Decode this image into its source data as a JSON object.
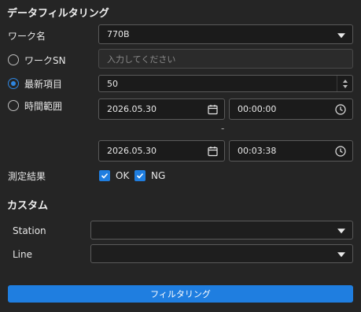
{
  "header": {
    "title": "データフィルタリング"
  },
  "work_name": {
    "label": "ワーク名",
    "value": "770B"
  },
  "work_sn": {
    "label": "ワークSN",
    "placeholder": "入力してください",
    "selected": false
  },
  "latest": {
    "label": "最新項目",
    "value": "50",
    "selected": true
  },
  "time_range": {
    "label": "時間範囲",
    "selected": false,
    "separator": "-",
    "start_date": "2026.05.30",
    "start_time": "00:00:00",
    "end_date": "2026.05.30",
    "end_time": "00:03:38"
  },
  "result": {
    "label": "測定結果",
    "ok_label": "OK",
    "ng_label": "NG",
    "ok_checked": true,
    "ng_checked": true
  },
  "custom": {
    "title": "カスタム",
    "station_label": "Station",
    "station_value": "",
    "line_label": "Line",
    "line_value": ""
  },
  "filter_button": {
    "label": "フィルタリング"
  },
  "colors": {
    "accent": "#1f7ee0",
    "background": "#252525",
    "field": "#1b1b1b"
  },
  "icons": [
    "chevron-down-icon",
    "calendar-icon",
    "clock-icon",
    "check-icon",
    "spinner-up-icon",
    "spinner-down-icon"
  ]
}
